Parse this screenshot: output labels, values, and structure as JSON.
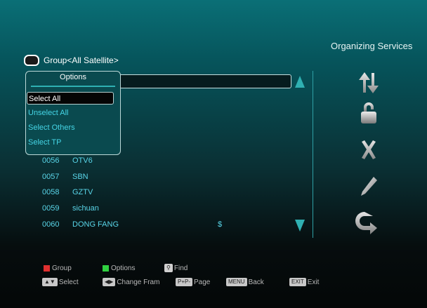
{
  "header": {
    "title": "Organizing Services",
    "group_label": "Group<All Satellite>"
  },
  "options_popup": {
    "title": "Options",
    "items": [
      {
        "label": "Select All",
        "selected": true
      },
      {
        "label": "Unselect All",
        "selected": false
      },
      {
        "label": "Select Others",
        "selected": false
      },
      {
        "label": "Select TP",
        "selected": false
      }
    ]
  },
  "channels": [
    {
      "num": "0056",
      "name": "OTV6",
      "flag": ""
    },
    {
      "num": "0057",
      "name": "SBN",
      "flag": ""
    },
    {
      "num": "0058",
      "name": "GZTV",
      "flag": ""
    },
    {
      "num": "0059",
      "name": "sichuan",
      "flag": ""
    },
    {
      "num": "0060",
      "name": "DONG FANG",
      "flag": "$"
    }
  ],
  "right_icons": [
    "move-icon",
    "lock-icon",
    "delete-icon",
    "rename-icon",
    "sort-icon"
  ],
  "footer": {
    "group": "Group",
    "options": "Options",
    "find": "Find",
    "select": "Select",
    "change_fram": "Change Fram",
    "pp_key": "P+P-",
    "page": "Page",
    "menu_key": "MENU",
    "back": "Back",
    "exit_key": "EXIT",
    "exit": "Exit"
  },
  "colors": {
    "accent": "#2fb0b2",
    "list_text": "#59d5e8",
    "red": "#e03030",
    "green": "#30d040"
  }
}
